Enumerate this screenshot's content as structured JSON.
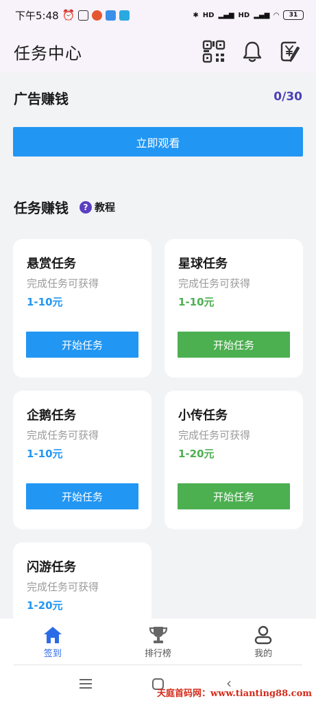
{
  "status_bar": {
    "time": "下午5:48",
    "battery": "31",
    "signal_labels": [
      "HD",
      "HD"
    ]
  },
  "header": {
    "title": "任务中心",
    "icons": [
      "qr-code-icon",
      "bell-icon",
      "yuan-edit-icon"
    ]
  },
  "ad": {
    "title": "广告赚钱",
    "count": "0/30",
    "button": "立即观看"
  },
  "tasks": {
    "title": "任务赚钱",
    "tutorial": "教程",
    "cards": [
      {
        "name": "悬赏任务",
        "desc": "完成任务可获得",
        "reward": "1-10元",
        "button": "开始任务",
        "color": "#2196f3"
      },
      {
        "name": "星球任务",
        "desc": "完成任务可获得",
        "reward": "1-10元",
        "button": "开始任务",
        "color": "#4caf50"
      },
      {
        "name": "企鹅任务",
        "desc": "完成任务可获得",
        "reward": "1-10元",
        "button": "开始任务",
        "color": "#2196f3"
      },
      {
        "name": "小传任务",
        "desc": "完成任务可获得",
        "reward": "1-20元",
        "button": "开始任务",
        "color": "#4caf50"
      },
      {
        "name": "闪游任务",
        "desc": "完成任务可获得",
        "reward": "1-20元"
      }
    ]
  },
  "bottom_nav": {
    "items": [
      {
        "label": "签到",
        "icon": "home-icon",
        "active": true
      },
      {
        "label": "排行榜",
        "icon": "trophy-icon",
        "active": false
      },
      {
        "label": "我的",
        "icon": "user-icon",
        "active": false
      }
    ]
  },
  "watermark": "天庭首码网：www.tianting88.com",
  "colors": {
    "accent_blue": "#2196f3",
    "accent_green": "#4caf50",
    "count_purple": "#4b3fb5",
    "nav_active": "#2c6be8"
  }
}
